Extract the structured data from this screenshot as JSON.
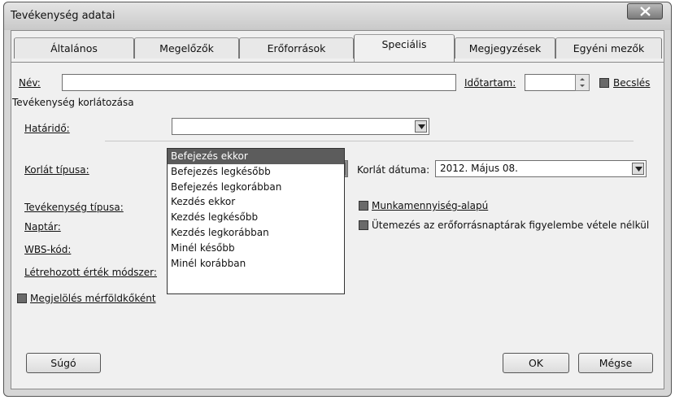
{
  "window": {
    "title": "Tevékenység adatai"
  },
  "tabs": [
    {
      "label": "Általános",
      "active": false
    },
    {
      "label": "Megelőzők",
      "active": false
    },
    {
      "label": "Erőforrások",
      "active": false
    },
    {
      "label": "Speciális",
      "active": true
    },
    {
      "label": "Megjegyzések",
      "active": false
    },
    {
      "label": "Egyéni mezők",
      "active": false
    }
  ],
  "form": {
    "name_label": "Név:",
    "name_value": "",
    "duration_label": "Időtartam:",
    "duration_value": "",
    "estimated_label": "Becslés",
    "estimated_checked": true,
    "constraint_section_label": "Tevékenység korlátozása",
    "deadline_label": "Határidő:",
    "deadline_value": "",
    "constraint_type_label": "Korlát típusa:",
    "constraint_type_value": "",
    "constraint_date_label": "Korlát dátuma:",
    "constraint_date_value": "2012. Május 08.",
    "task_type_label": "Tevékenység típusa:",
    "effort_driven_label": "Munkamennyiség-alapú",
    "effort_driven_checked": true,
    "calendar_label": "Naptár:",
    "ignore_resource_calendars_label": "Ütemezés az erőforrásnaptárak figyelembe vétele nélkül",
    "ignore_resource_calendars_checked": true,
    "wbs_label": "WBS-kód:",
    "earned_value_label": "Létrehozott érték módszer:",
    "milestone_label": "Megjelölés mérföldkőként",
    "milestone_checked": true
  },
  "constraint_type_options": [
    "Befejezés ekkor",
    "Befejezés legkésőbb",
    "Befejezés legkorábban",
    "Kezdés ekkor",
    "Kezdés legkésőbb",
    "Kezdés legkorábban",
    "Minél később",
    "Minél korábban"
  ],
  "constraint_type_highlighted_index": 0,
  "buttons": {
    "help": "Súgó",
    "ok": "OK",
    "cancel": "Mégse"
  }
}
